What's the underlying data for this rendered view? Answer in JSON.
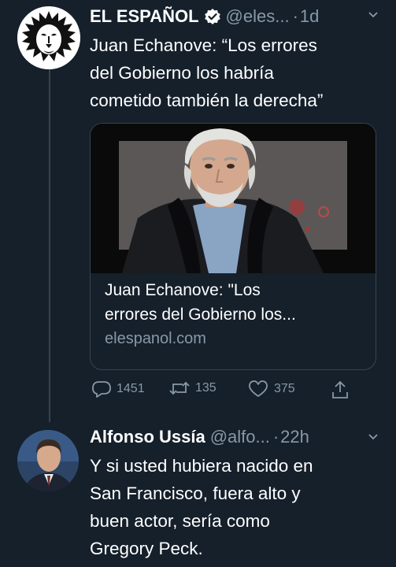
{
  "tweet1": {
    "author": "EL ESPAÑOL",
    "handle": "@eles...",
    "dot": "·",
    "time": "1d",
    "text": "Juan Echanove: “Los errores\ndel Gobierno los habría\ncometido también la derecha”",
    "card": {
      "title": "Juan Echanove: \"Los\nerrores del Gobierno los...",
      "domain": "elespanol.com"
    },
    "actions": {
      "replies": "1451",
      "retweets": "135",
      "likes": "375"
    }
  },
  "tweet2": {
    "author": "Alfonso Ussía",
    "handle": "@alfo...",
    "dot": "·",
    "time": "22h",
    "text": "Y si usted hubiera nacido en\nSan Francisco, fuera alto y\nbuen actor, sería como\nGregory Peck."
  },
  "colors": {
    "background": "#15202b",
    "secondary_text": "#8899a6",
    "divider": "#38444d",
    "verified_badge": "#ffffff"
  },
  "icons": [
    "lion-logo-icon",
    "verified-badge-icon",
    "chevron-down-icon",
    "reply-icon",
    "retweet-icon",
    "like-icon",
    "share-icon"
  ]
}
